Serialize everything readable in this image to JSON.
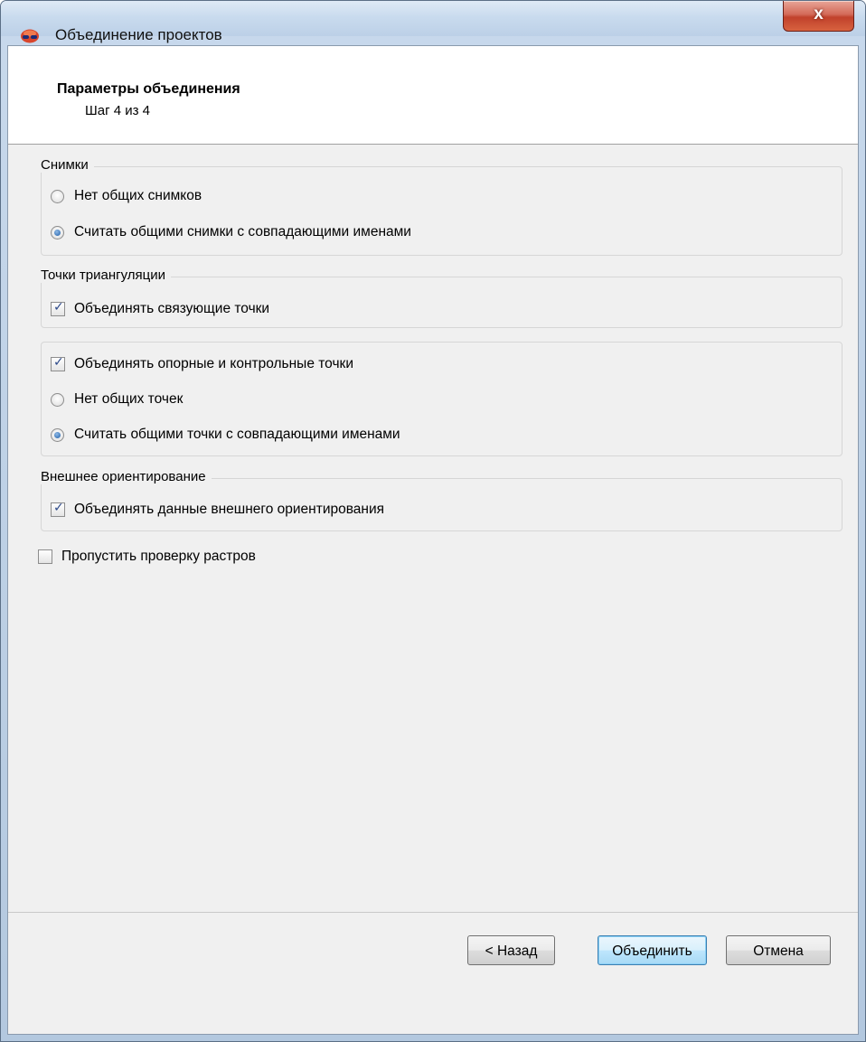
{
  "window": {
    "title": "Объединение проектов",
    "close_label": "x"
  },
  "header": {
    "title": "Параметры объединения",
    "step": "Шаг 4 из 4"
  },
  "groups": {
    "images": {
      "label": "Снимки",
      "options": [
        {
          "label": "Нет общих снимков",
          "selected": false
        },
        {
          "label": "Считать общими снимки с совпадающими именами",
          "selected": true
        }
      ]
    },
    "triangulation": {
      "label": "Точки триангуляции",
      "merge_tie_points": {
        "label": "Объединять связующие точки",
        "checked": true
      }
    },
    "gcp": {
      "merge_gcp": {
        "label": "Объединять опорные и контрольные точки",
        "checked": true
      },
      "options": [
        {
          "label": "Нет общих точек",
          "selected": false
        },
        {
          "label": "Считать общими точки с совпадающими именами",
          "selected": true
        }
      ]
    },
    "exterior": {
      "label": "Внешнее ориентирование",
      "merge_eo": {
        "label": "Объединять данные внешнего ориентирования",
        "checked": true
      }
    }
  },
  "skip_raster_check": {
    "label": "Пропустить проверку растров",
    "checked": false
  },
  "buttons": {
    "back": "< Назад",
    "merge": "Объединить",
    "cancel": "Отмена"
  },
  "colors": {
    "accent": "#1f5fa8",
    "close": "#c1412b"
  },
  "icons": [
    "app-logo-icon",
    "close-icon"
  ]
}
